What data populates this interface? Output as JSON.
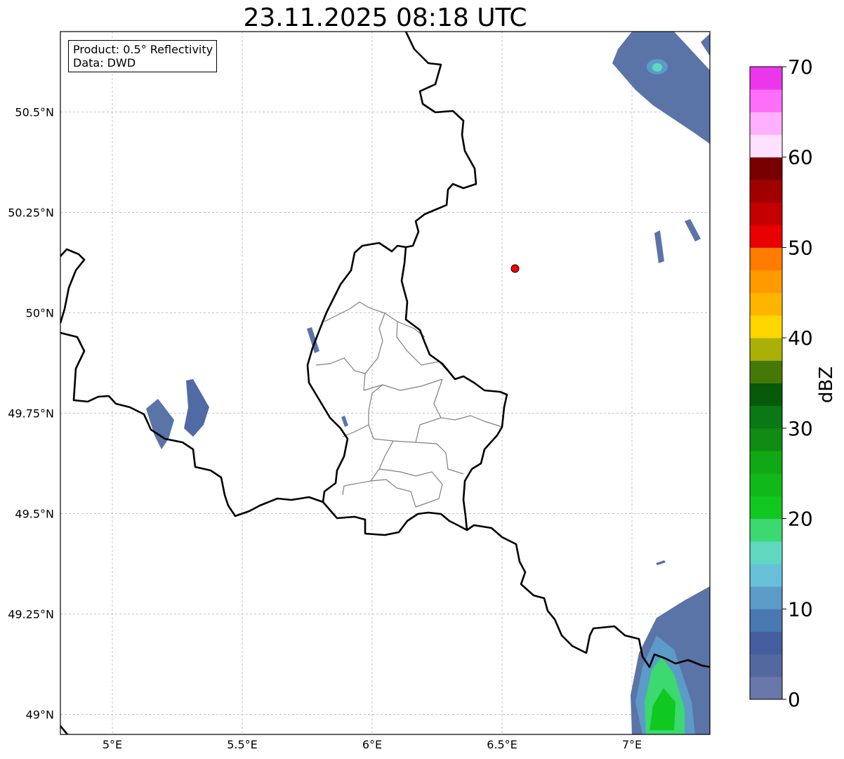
{
  "title": "23.11.2025 08:18 UTC",
  "info": {
    "product": "Product: 0.5° Reflectivity",
    "data": "Data: DWD"
  },
  "map": {
    "lon_range": [
      4.8,
      7.3
    ],
    "lat_range": [
      48.95,
      50.7
    ],
    "x_ticks": [
      {
        "value": 5.0,
        "label": "5°E"
      },
      {
        "value": 5.5,
        "label": "5.5°E"
      },
      {
        "value": 6.0,
        "label": "6°E"
      },
      {
        "value": 6.5,
        "label": "6.5°E"
      },
      {
        "value": 7.0,
        "label": "7°E"
      }
    ],
    "y_ticks": [
      {
        "value": 49.0,
        "label": "49°N"
      },
      {
        "value": 49.25,
        "label": "49.25°N"
      },
      {
        "value": 49.5,
        "label": "49.5°N"
      },
      {
        "value": 49.75,
        "label": "49.75°N"
      },
      {
        "value": 50.0,
        "label": "50°N"
      },
      {
        "value": 50.25,
        "label": "50.25°N"
      },
      {
        "value": 50.5,
        "label": "50.5°N"
      }
    ],
    "grid": true,
    "radar_site": {
      "lon": 6.55,
      "lat": 50.11,
      "color": "#ff0000"
    }
  },
  "colorbar": {
    "label": "dBZ",
    "min": 0,
    "max": 70,
    "tick_labels": [
      "0",
      "10",
      "20",
      "30",
      "40",
      "50",
      "60",
      "70"
    ],
    "colors": [
      "#6878a8",
      "#5468a0",
      "#445ea0",
      "#4a78b0",
      "#5c9ac8",
      "#68c0d8",
      "#60d8c0",
      "#3cd870",
      "#10c820",
      "#10b818",
      "#10a814",
      "#108c14",
      "#0a7814",
      "#065a0a",
      "#467808",
      "#aab008",
      "#ffd600",
      "#ffb400",
      "#ff9a00",
      "#ff7c00",
      "#e80000",
      "#c40000",
      "#a00000",
      "#780000",
      "#ffe0ff",
      "#ffb0ff",
      "#ff6ef8",
      "#ec36ec"
    ]
  }
}
